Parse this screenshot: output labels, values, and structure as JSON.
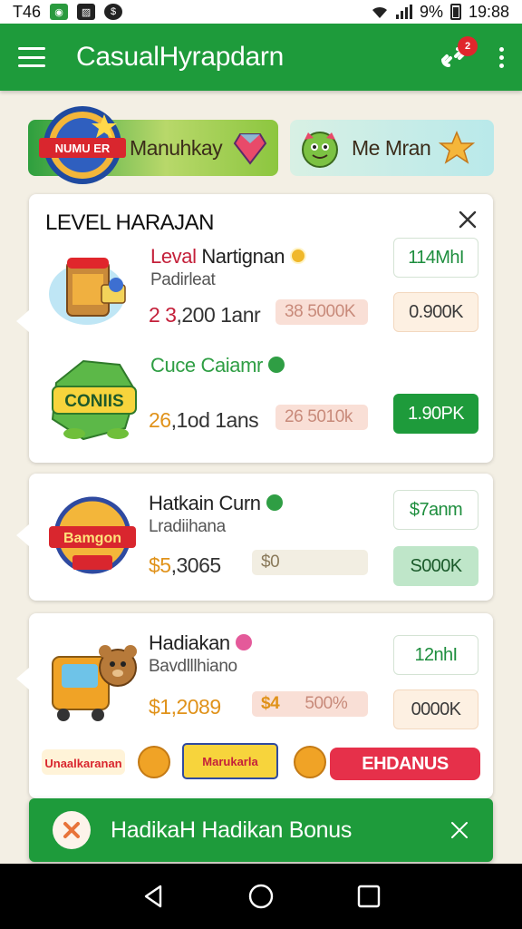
{
  "status_bar": {
    "time_left": "T46",
    "battery": "9%",
    "clock": "19:88",
    "icons": [
      "app-notification-icon",
      "gallery-icon",
      "dollar-icon",
      "wifi-icon",
      "signal-icon",
      "battery-icon"
    ]
  },
  "app_bar": {
    "title": "CasualHyrapdarn",
    "notification_count": "2",
    "icons": [
      "menu-icon",
      "link-icon",
      "more-vert-icon"
    ]
  },
  "promos": [
    {
      "label": "Manuhkay",
      "badge": "NUMU ER"
    },
    {
      "label": "Me Mran"
    }
  ],
  "card1": {
    "heading": "LEVEL HARAJAN",
    "rows": [
      {
        "title_lead": "Leval",
        "title_rest": " Nartignan",
        "subtitle": "Padirleat",
        "value_lead": "2 3",
        "value_rest": ",200 1anr",
        "chip": "38 5000K",
        "pill_top": "114MhI",
        "pill_bottom": "0.900K"
      },
      {
        "title": "Cuce Caiamr",
        "art_label": "CONIIS",
        "value_lead": "26",
        "value_rest": ",1od 1ans",
        "chip": "26 5010k",
        "pill": "1.90PK"
      }
    ]
  },
  "card2": {
    "title": "Hatkain Curn",
    "subtitle": "Lradiihana",
    "value_lead": "$5",
    "value_rest": ",3065",
    "chip": "$0",
    "pill_top": "$7anm",
    "pill_bottom": "S000K",
    "art_label": "Bamgon"
  },
  "card3": {
    "title": "Hadiakan",
    "subtitle": "Bavdlllhiano",
    "value_lead": "$1,2089",
    "chip_a": "$4",
    "chip_b": "500%",
    "pill_top": "12nhI",
    "pill_bottom": "0000K"
  },
  "bonus_strip": {
    "tag_1": "Unaalkaranan",
    "tag_2": "Marukarla",
    "button": "EHDANUS"
  },
  "snackbar": {
    "text": "HadikaH Hadikan Bonus"
  },
  "nav": {
    "icons": [
      "back-icon",
      "home-icon",
      "recents-icon"
    ]
  },
  "colors": {
    "primary_green": "#1e9b3b",
    "accent_red": "#e6304a",
    "gold": "#e0921a"
  }
}
